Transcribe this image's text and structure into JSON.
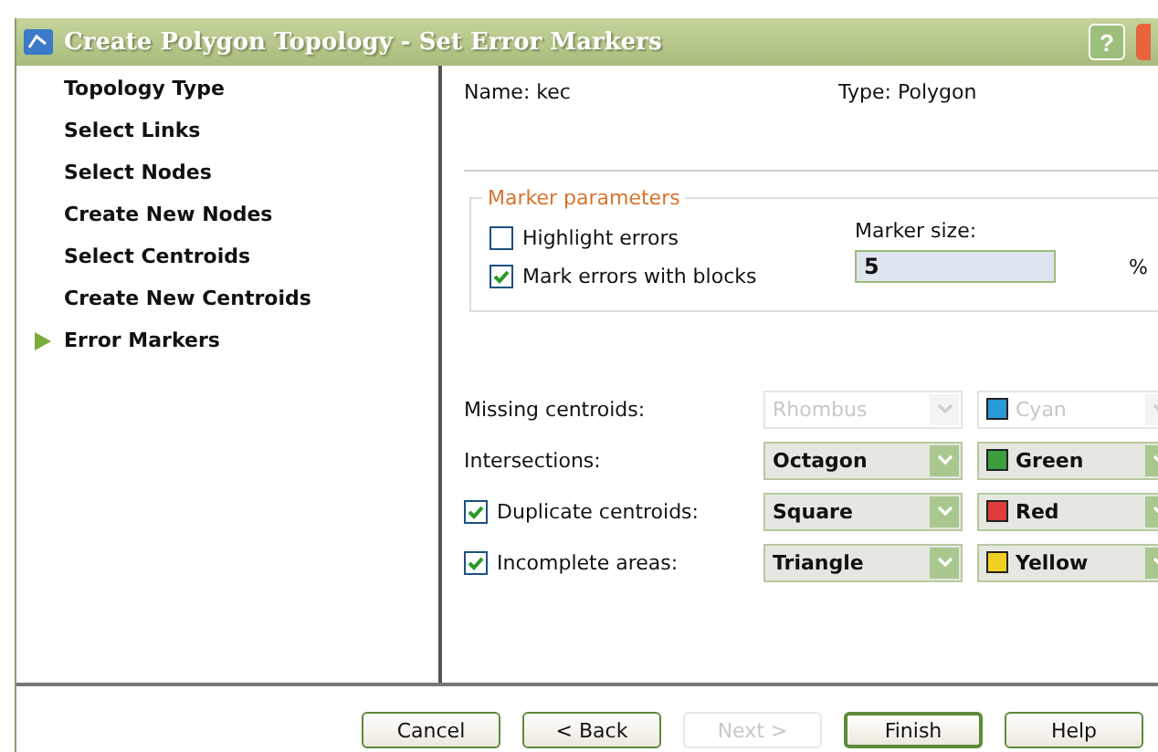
{
  "window": {
    "title": "Create Polygon Topology - Set Error Markers",
    "help_button": "?"
  },
  "sidebar": {
    "items": [
      {
        "label": "Topology Type",
        "selected": false
      },
      {
        "label": "Select Links",
        "selected": false
      },
      {
        "label": "Select Nodes",
        "selected": false
      },
      {
        "label": "Create New Nodes",
        "selected": false
      },
      {
        "label": "Select Centroids",
        "selected": false
      },
      {
        "label": "Create New Centroids",
        "selected": false
      },
      {
        "label": "Error Markers",
        "selected": true
      }
    ]
  },
  "info": {
    "name": "Name: kec",
    "type": "Type: Polygon"
  },
  "marker_parameters": {
    "title": "Marker parameters",
    "options": [
      {
        "label": "Highlight errors",
        "checked": false
      },
      {
        "label": "Mark errors with blocks",
        "checked": true
      }
    ],
    "size_label": "Marker size:",
    "size_value": "5",
    "unit": "%"
  },
  "error_rows": [
    {
      "kind": "label",
      "label": "Missing centroids:",
      "disabled": true,
      "shape": "Rhombus",
      "color_name": "Cyan",
      "color": "#2a9ad8"
    },
    {
      "kind": "label",
      "label": "Intersections:",
      "disabled": false,
      "shape": "Octagon",
      "color_name": "Green",
      "color": "#3c9e3c"
    },
    {
      "kind": "checkbox",
      "label": "Duplicate centroids:",
      "checked": true,
      "disabled": false,
      "shape": "Square",
      "color_name": "Red",
      "color": "#e03c3c"
    },
    {
      "kind": "checkbox",
      "label": "Incomplete areas:",
      "checked": true,
      "disabled": false,
      "shape": "Triangle",
      "color_name": "Yellow",
      "color": "#f0d020"
    }
  ],
  "buttons": [
    {
      "label": "Cancel",
      "disabled": false,
      "default": false
    },
    {
      "label": "< Back",
      "disabled": false,
      "default": false
    },
    {
      "label": "Next >",
      "disabled": true,
      "default": false
    },
    {
      "label": "Finish",
      "disabled": false,
      "default": true
    },
    {
      "label": "Help",
      "disabled": false,
      "default": false
    }
  ]
}
